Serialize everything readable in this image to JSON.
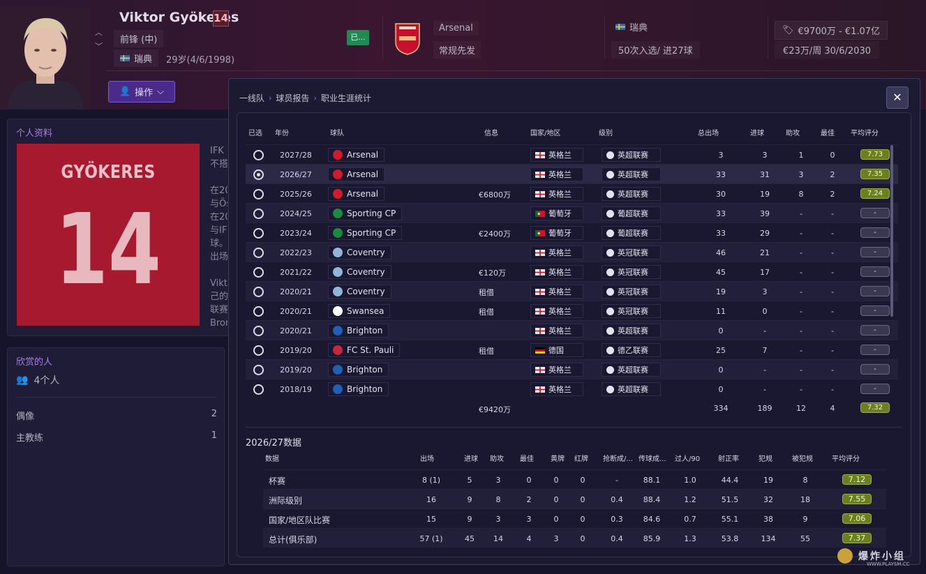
{
  "header": {
    "player_name": "Viktor Gyökeres",
    "shirt_number": "14",
    "position": "前锋 (中)",
    "nationality": "瑞典",
    "age": "29岁(4/6/1998)",
    "action_button": "操作",
    "status_chip": "已...",
    "club_name": "Arsenal",
    "club_role": "常规先发",
    "intl_nation": "瑞典",
    "intl_caps": "50次入选/ 进27球",
    "value_range": "€9700万 - €1.07亿",
    "wage_contract": "€23万/周  30/6/2030"
  },
  "profile": {
    "title": "个人资料",
    "shirt_name": "GYÖKERES",
    "shirt_number": "14",
    "snippets": [
      "IFK",
      "不搭",
      "",
      "在20",
      "与Ös",
      "在20",
      "与IF",
      "球。",
      "出场",
      "",
      "Vikt",
      "己的",
      "联赛",
      "Bron"
    ]
  },
  "admirers": {
    "title": "欣赏的人",
    "count": "4个人",
    "rows": [
      {
        "label": "偶像",
        "value": "2"
      },
      {
        "label": "主教练",
        "value": "1"
      }
    ]
  },
  "modal": {
    "breadcrumb": [
      "一线队",
      "球员报告",
      "职业生涯统计"
    ],
    "close": "✕",
    "career_headers": {
      "selected": "已选",
      "year": "年份",
      "team": "球队",
      "info": "信息",
      "nation": "国家/地区",
      "level": "级别",
      "apps": "总出场",
      "goals": "进球",
      "assists": "助攻",
      "pom": "最佳",
      "avg": "平均评分"
    },
    "career_rows": [
      {
        "year": "2027/28",
        "team": "Arsenal",
        "crest": "#d11a2a",
        "info": "",
        "nation": "英格兰",
        "flag": "eng",
        "league": "英超联赛",
        "apps": "3",
        "goals": "3",
        "assists": "1",
        "pom": "0",
        "avg": "7.73",
        "selected": false
      },
      {
        "year": "2026/27",
        "team": "Arsenal",
        "crest": "#d11a2a",
        "info": "",
        "nation": "英格兰",
        "flag": "eng",
        "league": "英超联赛",
        "apps": "33",
        "goals": "31",
        "assists": "3",
        "pom": "2",
        "avg": "7.35",
        "selected": true
      },
      {
        "year": "2025/26",
        "team": "Arsenal",
        "crest": "#d11a2a",
        "info": "€6800万",
        "nation": "英格兰",
        "flag": "eng",
        "league": "英超联赛",
        "apps": "30",
        "goals": "19",
        "assists": "8",
        "pom": "2",
        "avg": "7.24",
        "selected": false
      },
      {
        "year": "2024/25",
        "team": "Sporting CP",
        "crest": "#1a8a3e",
        "info": "",
        "nation": "葡萄牙",
        "flag": "por",
        "league": "葡超联赛",
        "apps": "33",
        "goals": "39",
        "assists": "-",
        "pom": "-",
        "avg": "-",
        "selected": false
      },
      {
        "year": "2023/24",
        "team": "Sporting CP",
        "crest": "#1a8a3e",
        "info": "€2400万",
        "nation": "葡萄牙",
        "flag": "por",
        "league": "葡超联赛",
        "apps": "33",
        "goals": "29",
        "assists": "-",
        "pom": "-",
        "avg": "-",
        "selected": false
      },
      {
        "year": "2022/23",
        "team": "Coventry",
        "crest": "#8fb6d8",
        "info": "",
        "nation": "英格兰",
        "flag": "eng",
        "league": "英冠联赛",
        "apps": "46",
        "goals": "21",
        "assists": "-",
        "pom": "-",
        "avg": "-",
        "selected": false
      },
      {
        "year": "2021/22",
        "team": "Coventry",
        "crest": "#8fb6d8",
        "info": "€120万",
        "nation": "英格兰",
        "flag": "eng",
        "league": "英冠联赛",
        "apps": "45",
        "goals": "17",
        "assists": "-",
        "pom": "-",
        "avg": "-",
        "selected": false
      },
      {
        "year": "2020/21",
        "team": "Coventry",
        "crest": "#8fb6d8",
        "info": "租借",
        "nation": "英格兰",
        "flag": "eng",
        "league": "英冠联赛",
        "apps": "19",
        "goals": "3",
        "assists": "-",
        "pom": "-",
        "avg": "-",
        "selected": false
      },
      {
        "year": "2020/21",
        "team": "Swansea",
        "crest": "#ffffff",
        "info": "租借",
        "nation": "英格兰",
        "flag": "eng",
        "league": "英冠联赛",
        "apps": "11",
        "goals": "0",
        "assists": "-",
        "pom": "-",
        "avg": "-",
        "selected": false
      },
      {
        "year": "2020/21",
        "team": "Brighton",
        "crest": "#1f5fb8",
        "info": "",
        "nation": "英格兰",
        "flag": "eng",
        "league": "英超联赛",
        "apps": "0",
        "goals": "-",
        "assists": "-",
        "pom": "-",
        "avg": "-",
        "selected": false
      },
      {
        "year": "2019/20",
        "team": "FC St. Pauli",
        "crest": "#c6283a",
        "info": "租借",
        "nation": "德国",
        "flag": "ger",
        "league": "德乙联赛",
        "apps": "25",
        "goals": "7",
        "assists": "-",
        "pom": "-",
        "avg": "-",
        "selected": false
      },
      {
        "year": "2019/20",
        "team": "Brighton",
        "crest": "#1f5fb8",
        "info": "",
        "nation": "英格兰",
        "flag": "eng",
        "league": "英超联赛",
        "apps": "0",
        "goals": "-",
        "assists": "-",
        "pom": "-",
        "avg": "-",
        "selected": false
      },
      {
        "year": "2018/19",
        "team": "Brighton",
        "crest": "#1f5fb8",
        "info": "",
        "nation": "英格兰",
        "flag": "eng",
        "league": "英超联赛",
        "apps": "0",
        "goals": "-",
        "assists": "-",
        "pom": "-",
        "avg": "-",
        "selected": false
      }
    ],
    "career_total": {
      "info": "€9420万",
      "apps": "334",
      "goals": "189",
      "assists": "12",
      "pom": "4",
      "avg": "7.32"
    },
    "season_title": "2026/27数据",
    "season_headers": {
      "data": "数据",
      "apps": "出场",
      "goals": "进球",
      "assists": "助攻",
      "pom": "最佳",
      "yellow": "黄牌",
      "red": "红牌",
      "tackles": "抢断成/...",
      "pass": "传球成...",
      "dribbles": "过人/90",
      "shot_acc": "射正率",
      "fouls": "犯规",
      "fouled": "被犯规",
      "avg": "平均评分"
    },
    "season_rows": [
      {
        "label": "杯赛",
        "apps": "8 (1)",
        "goals": "5",
        "assists": "3",
        "pom": "0",
        "yellow": "0",
        "red": "0",
        "tackles": "-",
        "pass": "88.1",
        "dribbles": "1.0",
        "shot_acc": "44.4",
        "fouls": "19",
        "fouled": "8",
        "avg": "7.12"
      },
      {
        "label": "洲际级别",
        "apps": "16",
        "goals": "9",
        "assists": "8",
        "pom": "2",
        "yellow": "0",
        "red": "0",
        "tackles": "0.4",
        "pass": "88.4",
        "dribbles": "1.2",
        "shot_acc": "51.5",
        "fouls": "32",
        "fouled": "18",
        "avg": "7.55"
      },
      {
        "label": "国家/地区队比赛",
        "apps": "15",
        "goals": "9",
        "assists": "3",
        "pom": "3",
        "yellow": "0",
        "red": "0",
        "tackles": "0.3",
        "pass": "84.6",
        "dribbles": "0.7",
        "shot_acc": "55.1",
        "fouls": "38",
        "fouled": "9",
        "avg": "7.06"
      },
      {
        "label": "总计(俱乐部)",
        "apps": "57 (1)",
        "goals": "45",
        "assists": "14",
        "pom": "4",
        "yellow": "3",
        "red": "0",
        "tackles": "0.4",
        "pass": "85.9",
        "dribbles": "1.3",
        "shot_acc": "53.8",
        "fouls": "134",
        "fouled": "55",
        "avg": "7.37"
      }
    ]
  },
  "watermark": {
    "text": "爆炸小组",
    "url": "WWW.PLAYSM.CC",
    "logo": "ops"
  },
  "colors": {
    "accent": "#7d5bd0",
    "rating_good": "#6b7f1e",
    "arsenal_red": "#a6192e"
  }
}
